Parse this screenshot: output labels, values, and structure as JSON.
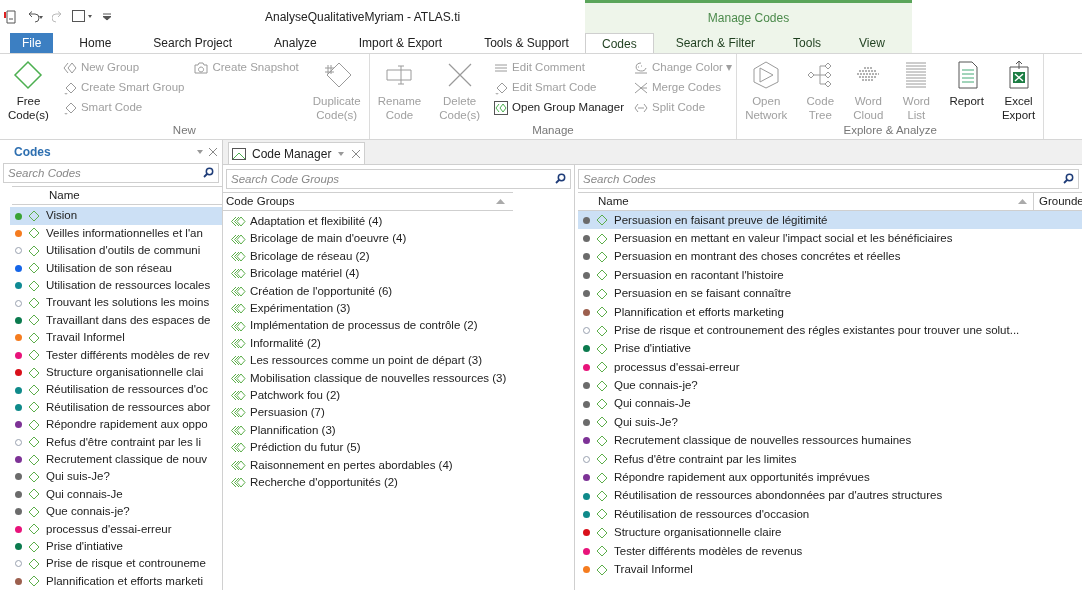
{
  "window": {
    "title": "AnalyseQualitativeMyriam - ATLAS.ti",
    "context_header": "Manage Codes"
  },
  "tabs": [
    {
      "label": "File",
      "selected": false,
      "kind": "file",
      "contextual": false
    },
    {
      "label": "Home",
      "selected": false,
      "kind": "tab",
      "contextual": false
    },
    {
      "label": "Search Project",
      "selected": false,
      "kind": "tab",
      "contextual": false
    },
    {
      "label": "Analyze",
      "selected": false,
      "kind": "tab",
      "contextual": false
    },
    {
      "label": "Import & Export",
      "selected": false,
      "kind": "tab",
      "contextual": false
    },
    {
      "label": "Tools & Support",
      "selected": false,
      "kind": "tab",
      "contextual": false
    },
    {
      "label": "Codes",
      "selected": true,
      "kind": "tab",
      "contextual": true
    },
    {
      "label": "Search & Filter",
      "selected": false,
      "kind": "tab",
      "contextual": true
    },
    {
      "label": "Tools",
      "selected": false,
      "kind": "tab",
      "contextual": true
    },
    {
      "label": "View",
      "selected": false,
      "kind": "tab",
      "contextual": true
    }
  ],
  "ribbon": [
    {
      "label": "New",
      "columns": [
        [
          {
            "kind": "big",
            "lines": [
              "Free",
              "Code(s)"
            ],
            "disabled": false
          }
        ],
        [
          {
            "kind": "small",
            "label": "New Group",
            "disabled": true
          },
          {
            "kind": "small",
            "label": "Create Smart Group",
            "disabled": true
          },
          {
            "kind": "small",
            "label": "Smart Code",
            "disabled": true
          }
        ],
        [
          {
            "kind": "small",
            "label": "Create Snapshot",
            "disabled": true
          }
        ],
        [
          {
            "kind": "big",
            "lines": [
              "Duplicate",
              "Code(s)"
            ],
            "disabled": true
          }
        ]
      ]
    },
    {
      "label": "Manage",
      "columns": [
        [
          {
            "kind": "big",
            "lines": [
              "Rename",
              "Code"
            ],
            "disabled": true
          }
        ],
        [
          {
            "kind": "big",
            "lines": [
              "Delete",
              "Code(s)"
            ],
            "disabled": true
          }
        ],
        [
          {
            "kind": "small",
            "label": "Edit Comment",
            "disabled": true
          },
          {
            "kind": "small",
            "label": "Edit Smart Code",
            "disabled": true
          },
          {
            "kind": "small",
            "label": "Open Group Manager",
            "disabled": false
          }
        ],
        [
          {
            "kind": "small",
            "label": "Change Color ▾",
            "disabled": true
          },
          {
            "kind": "small",
            "label": "Merge Codes",
            "disabled": true
          },
          {
            "kind": "small",
            "label": "Split Code",
            "disabled": true
          }
        ]
      ]
    },
    {
      "label": "Explore & Analyze",
      "columns": [
        [
          {
            "kind": "big",
            "lines": [
              "Open",
              "Network"
            ],
            "disabled": true
          }
        ],
        [
          {
            "kind": "big",
            "lines": [
              "Code",
              "Tree"
            ],
            "disabled": true
          }
        ],
        [
          {
            "kind": "big",
            "lines": [
              "Word",
              "Cloud"
            ],
            "disabled": true
          }
        ],
        [
          {
            "kind": "big",
            "lines": [
              "Word",
              "List"
            ],
            "disabled": true
          }
        ],
        [
          {
            "kind": "big",
            "lines": [
              "Report"
            ],
            "disabled": false
          }
        ],
        [
          {
            "kind": "big",
            "lines": [
              "Excel",
              "Export"
            ],
            "disabled": false
          }
        ]
      ]
    }
  ],
  "codes_panel": {
    "title": "Codes",
    "search": {
      "placeholder": "Search Codes"
    },
    "column": "Name",
    "items": [
      {
        "name": "Vision",
        "color": "#3aa335",
        "selected": true
      },
      {
        "name": "Veilles informationnelles et l'an",
        "color": "#f57c1f",
        "selected": false
      },
      {
        "name": "Utilisation d'outils de communi",
        "hollow": true,
        "selected": false
      },
      {
        "name": "Utilisation de son réseau",
        "color": "#1565e8",
        "selected": false
      },
      {
        "name": "Utilisation de ressources locales",
        "color": "#0f8a94",
        "selected": false
      },
      {
        "name": "Trouvant les solutions les moins",
        "hollow": true,
        "selected": false
      },
      {
        "name": "Travaillant dans des espaces de",
        "color": "#0b7a4e",
        "selected": false
      },
      {
        "name": "Travail Informel",
        "color": "#f57c1f",
        "selected": false
      },
      {
        "name": "Tester différents modèles de rev",
        "color": "#e8137a",
        "selected": false
      },
      {
        "name": "Structure organisationnelle clai",
        "color": "#d9101a",
        "selected": false
      },
      {
        "name": "Réutilisation de ressources d'oc",
        "color": "#0f8a8a",
        "selected": false
      },
      {
        "name": "Réutilisation de ressources abor",
        "color": "#0f8a8a",
        "selected": false
      },
      {
        "name": "Répondre rapidement aux oppo",
        "color": "#7d3296",
        "selected": false
      },
      {
        "name": "Refus d'être contraint par les li",
        "hollow": true,
        "selected": false
      },
      {
        "name": "Recrutement classique de nouv",
        "color": "#7d3296",
        "selected": false
      },
      {
        "name": "Qui suis-Je?",
        "color": "#6b6b6b",
        "selected": false
      },
      {
        "name": "Qui connais-Je",
        "color": "#6b6b6b",
        "selected": false
      },
      {
        "name": "Que connais-je?",
        "color": "#6b6b6b",
        "selected": false
      },
      {
        "name": "processus d'essai-erreur",
        "color": "#e8137a",
        "selected": false
      },
      {
        "name": "Prise d'intiative",
        "color": "#0b7a4e",
        "selected": false
      },
      {
        "name": "Prise de risque et controuneme",
        "hollow": true,
        "selected": false
      },
      {
        "name": "Plannification et efforts marketi",
        "color": "#9c5f4e",
        "selected": false
      }
    ]
  },
  "manager_tab": {
    "title": "Code Manager"
  },
  "groups_panel": {
    "search": {
      "placeholder": "Search Code Groups"
    },
    "column": "Code Groups",
    "items": [
      "Adaptation et flexibilité (4)",
      "Bricolage de main d'oeuvre (4)",
      "Bricolage de réseau (2)",
      "Bricolage matériel (4)",
      "Création de l'opportunité (6)",
      "Expérimentation (3)",
      "Implémentation de processus de contrôle (2)",
      "Informalité (2)",
      "Les ressources comme un point de départ (3)",
      "Mobilisation classique de nouvelles ressources (3)",
      "Patchwork fou (2)",
      "Persuasion (7)",
      "Plannification (3)",
      "Prédiction du futur (5)",
      "Raisonnement en pertes abordables (4)",
      "Recherche d'opportunités (2)"
    ]
  },
  "manager_codes": {
    "search": {
      "placeholder": "Search Codes"
    },
    "columns": [
      "Name",
      "Grounde"
    ],
    "items": [
      {
        "name": "Persuasion en faisant preuve de légitimité",
        "color": "#6b6b6b",
        "selected": true
      },
      {
        "name": "Persuasion en mettant en valeur l'impact social et les bénéficiaires",
        "color": "#6b6b6b",
        "selected": false
      },
      {
        "name": "Persuasion en montrant des choses concrétes et réelles",
        "color": "#6b6b6b",
        "selected": false
      },
      {
        "name": "Persuasion en racontant l'histoire",
        "color": "#6b6b6b",
        "selected": false
      },
      {
        "name": "Persuasion en se faisant connaître",
        "color": "#6b6b6b",
        "selected": false
      },
      {
        "name": "Plannification et efforts marketing",
        "color": "#9c5f4e",
        "selected": false
      },
      {
        "name": "Prise de risque et controunement des régles existantes pour trouver une solut...",
        "hollow": true,
        "selected": false
      },
      {
        "name": "Prise d'intiative",
        "color": "#0b7a4e",
        "selected": false
      },
      {
        "name": "processus d'essai-erreur",
        "color": "#e8137a",
        "selected": false
      },
      {
        "name": "Que connais-je?",
        "color": "#6b6b6b",
        "selected": false
      },
      {
        "name": "Qui connais-Je",
        "color": "#6b6b6b",
        "selected": false
      },
      {
        "name": "Qui suis-Je?",
        "color": "#6b6b6b",
        "selected": false
      },
      {
        "name": "Recrutement classique de nouvelles ressources humaines",
        "color": "#7d3296",
        "selected": false
      },
      {
        "name": "Refus d'être contraint par les limites",
        "hollow": true,
        "selected": false
      },
      {
        "name": "Répondre rapidement aux opportunités imprévues",
        "color": "#7d3296",
        "selected": false
      },
      {
        "name": "Réutilisation de ressources abondonnées par d'autres structures",
        "color": "#0f8a8a",
        "selected": false
      },
      {
        "name": "Réutilisation de ressources d'occasion",
        "color": "#0f8a8a",
        "selected": false
      },
      {
        "name": "Structure organisationnelle claire",
        "color": "#d9101a",
        "selected": false
      },
      {
        "name": "Tester différents modèles de revenus",
        "color": "#e8137a",
        "selected": false
      },
      {
        "name": "Travail Informel",
        "color": "#f57c1f",
        "selected": false
      }
    ]
  }
}
